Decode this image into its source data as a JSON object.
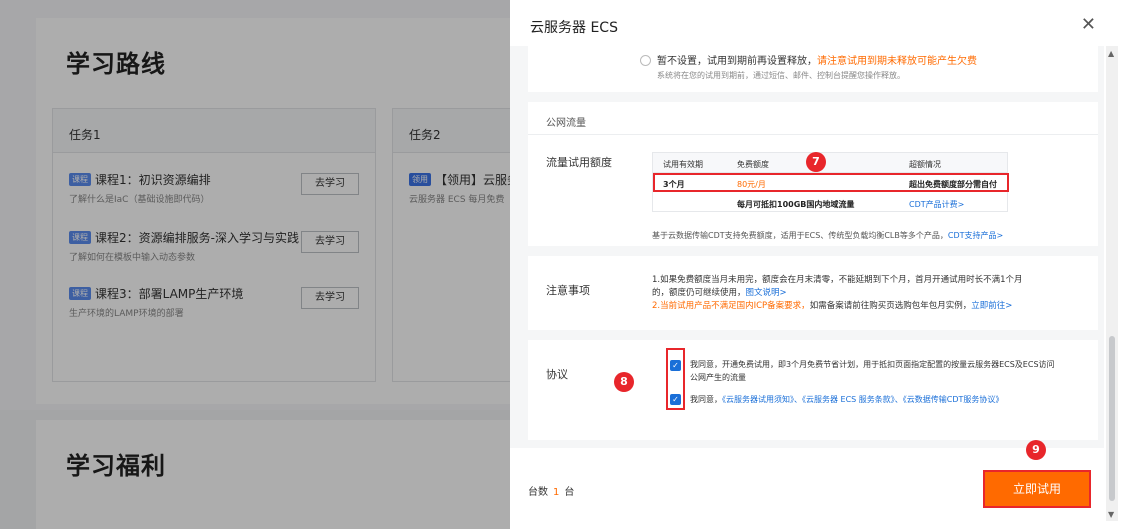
{
  "background": {
    "section_title": "学习路线",
    "tasks": [
      {
        "label": "任务1",
        "courses": [
          {
            "tag": "课程",
            "title": "课程1：初识资源编排",
            "desc": "了解什么是IaC（基础设施即代码）",
            "button": "去学习"
          },
          {
            "tag": "课程",
            "title": "课程2：资源编排服务-深入学习与实践",
            "desc": "了解如何在模板中输入动态参数",
            "button": "去学习"
          },
          {
            "tag": "课程",
            "title": "课程3：部署LAMP生产环境",
            "desc": "生产环境的LAMP环境的部署",
            "button": "去学习"
          }
        ]
      },
      {
        "label": "任务2",
        "courses": [
          {
            "tag": "领用",
            "title": "【领用】云服务",
            "desc": "云服务器 ECS 每月免费"
          }
        ]
      }
    ],
    "section2_title": "学习福利"
  },
  "drawer": {
    "title": "云服务器 ECS",
    "close_icon": "close-icon",
    "release": {
      "option_label": "暂不设置，试用到期前再设置释放，",
      "option_warning": "请注意试用到期未释放可能产生欠费",
      "note": "系统将在您的试用到期前，通过短信、邮件、控制台提醒您操作释放。"
    },
    "traffic": {
      "section_title": "公网流量",
      "field_label": "流量试用额度",
      "columns": [
        "试用有效期",
        "免费额度",
        "超额情况"
      ],
      "row1": {
        "period": "3个月",
        "quota": "80元/月",
        "overage": "超出免费额度部分需自付"
      },
      "row2": {
        "quota": "每月可抵扣100GB国内地域流量",
        "link": "CDT产品计费>"
      },
      "note": "基于云数据传输CDT支持免费额度，适用于ECS、传统型负载均衡CLB等多个产品，",
      "note_link": "CDT支持产品>"
    },
    "notes": {
      "field_label": "注意事项",
      "line1": "1.如果免费额度当月未用完，额度会在月末清零，不能延期到下个月，首月开通试用时长不满1个月",
      "line2": "的，额度仍可继续使用，",
      "line2_link": "图文说明>",
      "line3_warn": "2.当前试用产品不满足国内ICP备案要求，",
      "line3": "如需备案请前往购买页选购包年包月实例，",
      "line3_link": "立即前往>"
    },
    "agreement": {
      "field_label": "协议",
      "check1_line1": "我同意，开通免费试用，即3个月免费节省计划，用于抵扣页面指定配置的按量云服务器ECS及ECS访问",
      "check1_line2": "公网产生的流量",
      "check2_prefix": "我同意，",
      "check2_links": "《云服务器试用须知》、《云服务器 ECS 服务条款》、《云数据传输CDT服务协议》"
    },
    "footer": {
      "qty_label": "台数",
      "qty_value": "1",
      "qty_unit": "台",
      "submit_label": "立即试用"
    }
  },
  "annotations": {
    "badge7": "7",
    "badge8": "8",
    "badge9": "9"
  },
  "colors": {
    "accent": "#ff6a00",
    "link": "#1a6fd8",
    "highlight": "#e8262b"
  }
}
